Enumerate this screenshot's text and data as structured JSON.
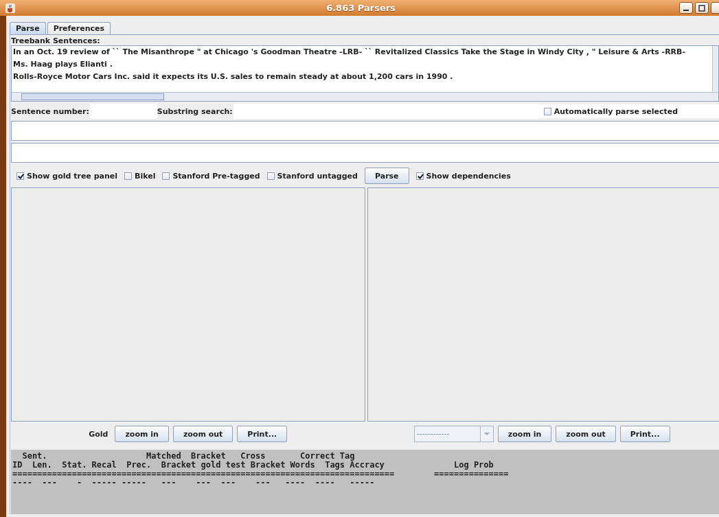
{
  "window": {
    "title": "6.863 Parsers"
  },
  "tabs": [
    {
      "label": "Parse",
      "selected": true
    },
    {
      "label": "Preferences",
      "selected": false
    }
  ],
  "treebank": {
    "label": "Treebank Sentences:",
    "lines": [
      "In an Oct. 19 review of `` The Misanthrope \" at Chicago 's Goodman Theatre -LRB- `` Revitalized Classics Take the Stage in Windy City , \" Leisure & Arts -RRB-",
      "Ms. Haag plays Elianti .",
      "Rolls-Royce Motor Cars Inc. said it expects its U.S. sales to remain steady at about 1,200 cars in 1990 ."
    ]
  },
  "search_row": {
    "sentence_number_label": "Sentence number:",
    "substring_label": "Substring search:",
    "auto_parse": {
      "label": "Automatically parse selected",
      "checked": false
    }
  },
  "options": [
    {
      "kind": "checkbox",
      "label": "Show gold tree panel",
      "checked": true
    },
    {
      "kind": "checkbox",
      "label": "Bikel",
      "checked": false
    },
    {
      "kind": "checkbox",
      "label": "Stanford Pre-tagged",
      "checked": false
    },
    {
      "kind": "checkbox",
      "label": "Stanford untagged",
      "checked": false
    },
    {
      "kind": "button",
      "label": "Parse"
    },
    {
      "kind": "checkbox",
      "label": "Show dependencies",
      "checked": true
    }
  ],
  "left_controls": {
    "label": "Gold",
    "buttons": [
      "zoom in",
      "zoom out",
      "Print..."
    ]
  },
  "right_controls": {
    "selector": {
      "value": "------------",
      "disabled": true
    },
    "buttons": [
      "zoom in",
      "zoom out",
      "Print..."
    ]
  },
  "stats": [
    "  Sent.                    Matched  Bracket   Cross       Correct Tag",
    "ID  Len.  Stat. Recal  Prec.  Bracket gold test Bracket Words  Tags Accracy              Log Prob",
    "=============================================================================        ===============",
    "----  ---    -  ----- -----   ---    ---  ---    ---   ----  ----   -----"
  ]
}
